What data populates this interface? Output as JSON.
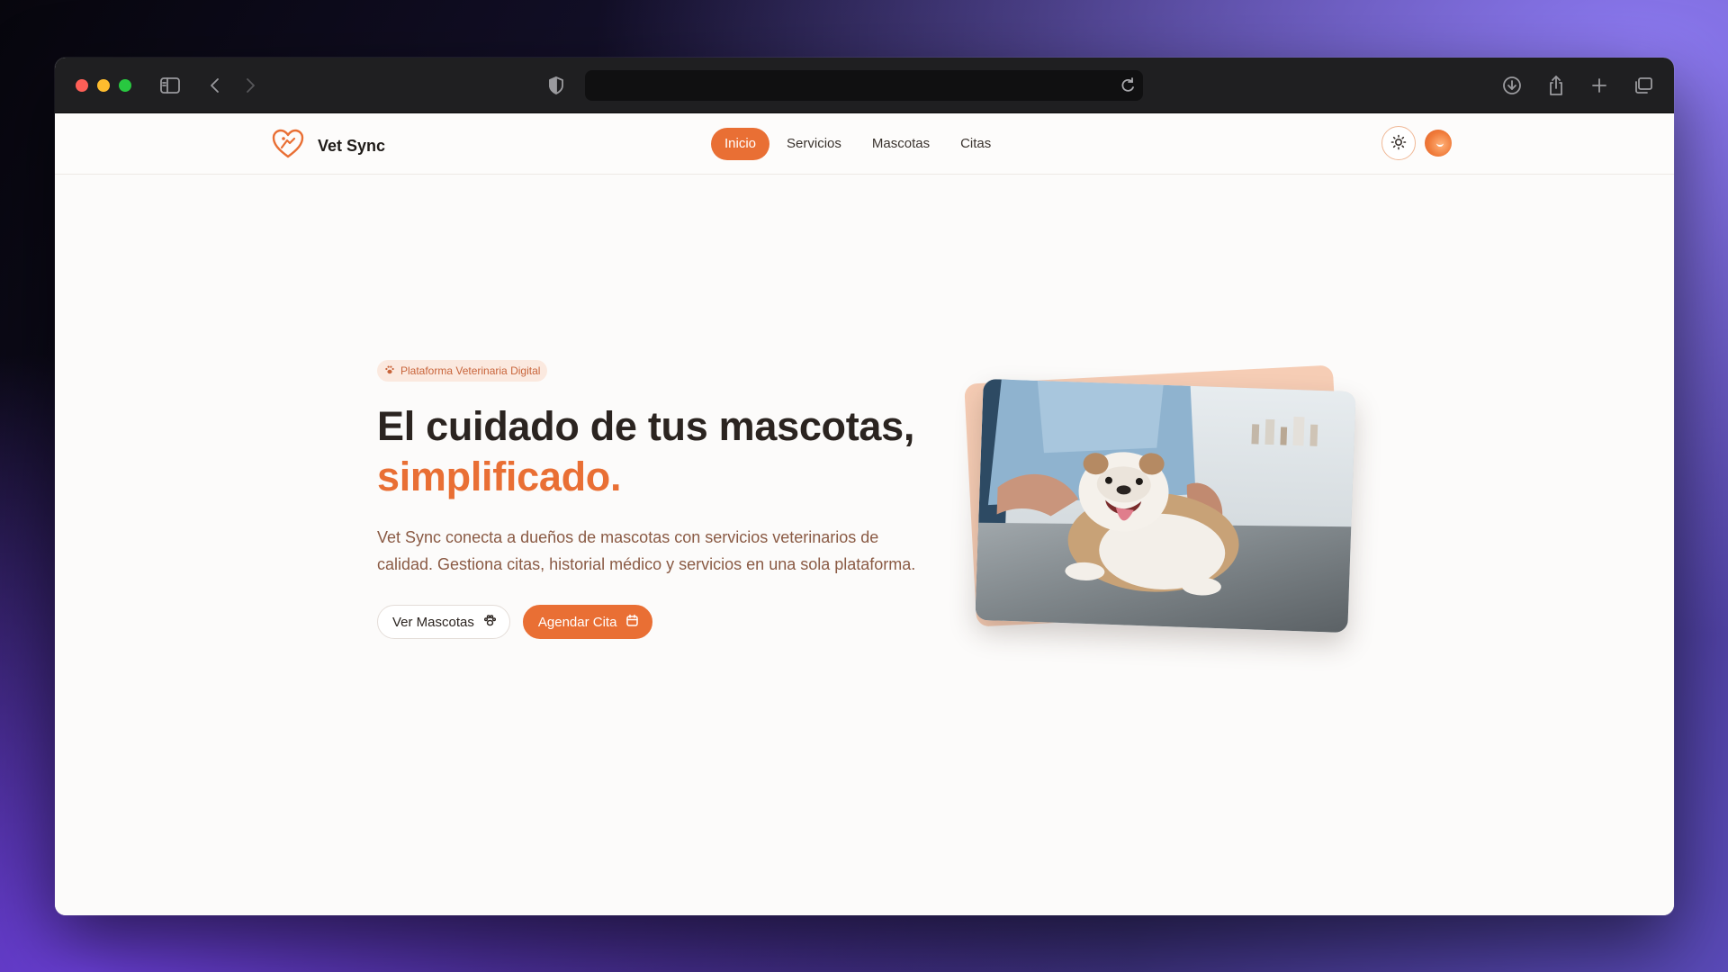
{
  "browser": {
    "url": "",
    "icons": [
      "sidebar-icon",
      "back-icon",
      "forward-icon",
      "shield-icon",
      "reload-icon",
      "download-icon",
      "share-icon",
      "new-tab-icon",
      "tabs-overview-icon"
    ]
  },
  "nav": {
    "brand": "Vet Sync",
    "items": [
      {
        "label": "Inicio",
        "active": true
      },
      {
        "label": "Servicios",
        "active": false
      },
      {
        "label": "Mascotas",
        "active": false
      },
      {
        "label": "Citas",
        "active": false
      }
    ]
  },
  "hero": {
    "badge": "Plataforma Veterinaria Digital",
    "title_line1": "El cuidado de tus mascotas,",
    "title_line2": "simplificado.",
    "description": "Vet Sync conecta a dueños de mascotas con servicios veterinarios de calidad. Gestiona citas, historial médico y servicios en una sola plataforma.",
    "cta_secondary": "Ver Mascotas",
    "cta_primary": "Agendar Cita"
  },
  "colors": {
    "accent": "#e96f34",
    "accent_soft": "#fbe9df",
    "text_dark": "#2b2420",
    "text_muted": "#8a5a44"
  }
}
